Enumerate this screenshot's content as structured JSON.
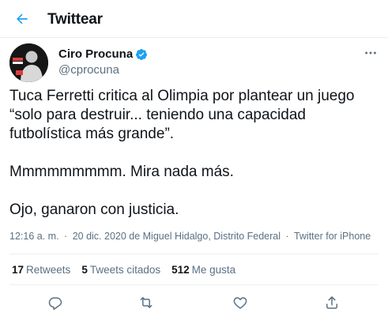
{
  "header": {
    "title": "Twittear",
    "back_icon": "arrow-left-icon"
  },
  "author": {
    "name": "Ciro Procuna",
    "handle": "@cprocuna",
    "verified": true
  },
  "tweet": {
    "lines": [
      "Tuca Ferretti critica al Olimpia por plantear un juego",
      "“solo para destruir... teniendo una capacidad",
      "futbolística más grande”.",
      "Mmmmmmmmm. Mira nada más.",
      "Ojo, ganaron con justicia."
    ]
  },
  "meta": {
    "time": "12:16 a. m.",
    "date": "20 dic. 2020 de Miguel Hidalgo, Distrito Federal",
    "source": "Twitter for iPhone",
    "separator": "·"
  },
  "stats": {
    "retweets_count": "17",
    "retweets_label": "Retweets",
    "quotes_count": "5",
    "quotes_label": "Tweets citados",
    "likes_count": "512",
    "likes_label": "Me gusta"
  },
  "colors": {
    "accent": "#1da1f2",
    "text": "#0f1419",
    "secondary": "#5b7083",
    "divider": "#ebeef0"
  },
  "icons": [
    "arrow-left-icon",
    "verified-icon",
    "more-icon",
    "reply-icon",
    "retweet-icon",
    "like-icon",
    "share-icon"
  ]
}
